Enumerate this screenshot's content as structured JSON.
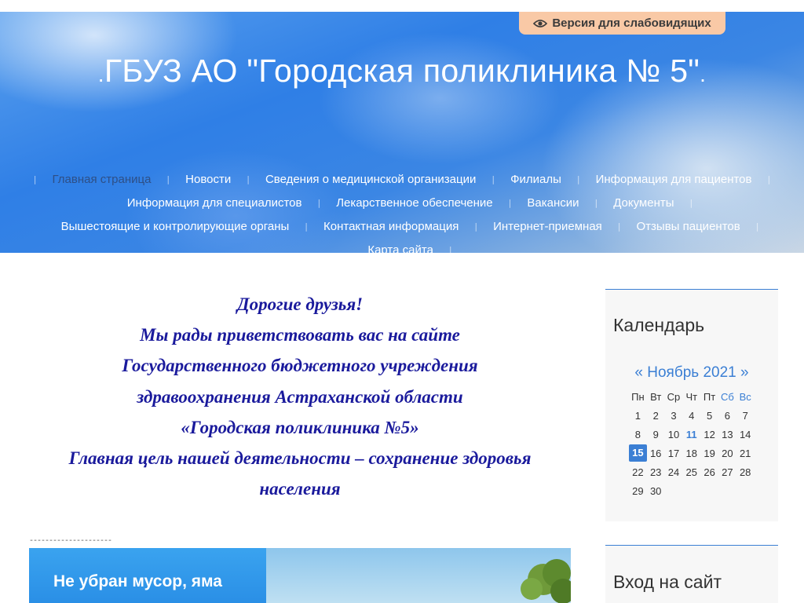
{
  "accessibility": {
    "label": "Версия для слабовидящих",
    "icon": "eye-icon"
  },
  "site": {
    "title": "ГБУЗ АО \"Городская поликлиника № 5\""
  },
  "nav": {
    "rows": [
      [
        {
          "label": "Главная страница",
          "active": true
        },
        {
          "label": "Новости"
        },
        {
          "label": "Сведения о медицинской организации"
        },
        {
          "label": "Филиалы"
        },
        {
          "label": "Информация для пациентов"
        }
      ],
      [
        {
          "label": "Информация для специалистов"
        },
        {
          "label": "Лекарственное обеспечение"
        },
        {
          "label": "Вакансии"
        },
        {
          "label": "Документы"
        }
      ],
      [
        {
          "label": "Вышестоящие и контролирующие органы"
        },
        {
          "label": "Контактная информация"
        },
        {
          "label": "Интернет-приемная"
        },
        {
          "label": "Отзывы пациентов"
        }
      ],
      [
        {
          "label": "Карта сайта"
        }
      ]
    ]
  },
  "welcome": {
    "lines": [
      "Дорогие друзья!",
      "Мы рады приветствовать вас на сайте",
      "Государственного бюджетного учреждения",
      "здравоохранения  Астраханской области",
      "«Городская поликлиника №5»",
      "Главная цель нашей деятельности – сохранение здоровья",
      "населения"
    ]
  },
  "divider": "---------------------",
  "banner": {
    "text": "Не убран мусор, яма"
  },
  "calendar": {
    "title": "Календарь",
    "prev": "«",
    "month": "Ноябрь 2021",
    "next": "»",
    "weekdays": [
      "Пн",
      "Вт",
      "Ср",
      "Чт",
      "Пт",
      "Сб",
      "Вс"
    ],
    "weeks": [
      [
        "1",
        "2",
        "3",
        "4",
        "5",
        "6",
        "7"
      ],
      [
        "8",
        "9",
        "10",
        "11",
        "12",
        "13",
        "14"
      ],
      [
        "15",
        "16",
        "17",
        "18",
        "19",
        "20",
        "21"
      ],
      [
        "22",
        "23",
        "24",
        "25",
        "26",
        "27",
        "28"
      ],
      [
        "29",
        "30",
        "",
        "",
        "",
        "",
        ""
      ]
    ],
    "today": "15",
    "linked": [
      "11"
    ]
  },
  "login": {
    "title": "Вход на сайт"
  },
  "colors": {
    "accent": "#3b7fd4",
    "welcome_text": "#1a1a9c",
    "access_bg": "#f9c9a6"
  }
}
